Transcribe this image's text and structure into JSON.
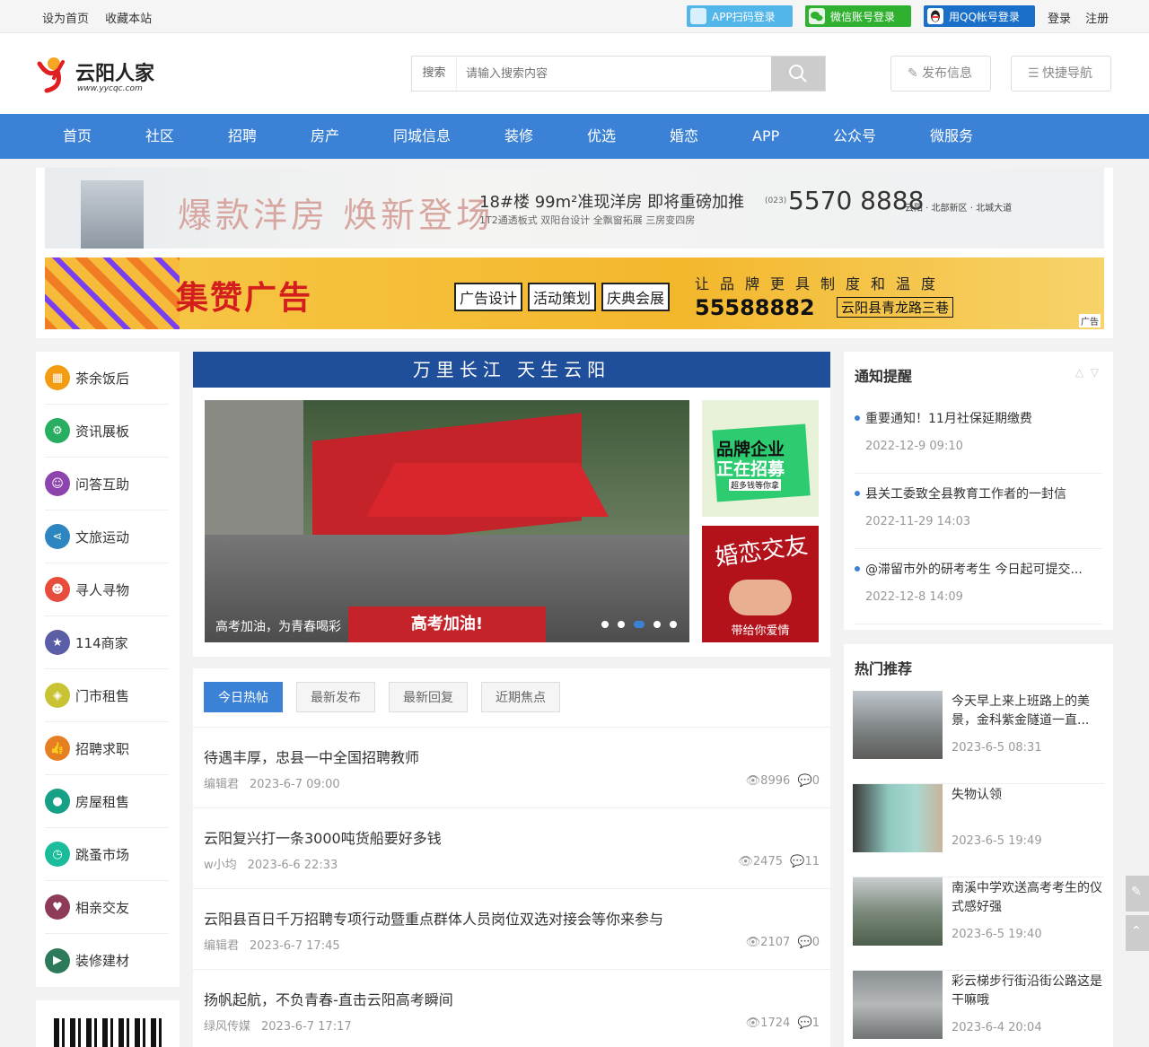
{
  "topbar": {
    "set_home": "设为首页",
    "bookmark": "收藏本站",
    "app_login": "APP扫码登录",
    "wechat_login": "微信账号登录",
    "qq_login": "用QQ帐号登录",
    "login": "登录",
    "register": "注册"
  },
  "header": {
    "logo_text": "云阳人家",
    "logo_url": "www.yycqc.com",
    "search_label": "搜索",
    "search_placeholder": "请输入搜索内容",
    "publish": "发布信息",
    "quick_nav": "快捷导航"
  },
  "nav": [
    "首页",
    "社区",
    "招聘",
    "房产",
    "同城信息",
    "装修",
    "优选",
    "婚恋",
    "APP",
    "公众号",
    "微服务"
  ],
  "banner1": {
    "headline": "爆款洋房 焕新登场",
    "line1": "18#楼 99m²准现洋房 即将重磅加推",
    "line2": "1T2通透板式  双阳台设计  全飘窗拓展  三房变四房",
    "phone_prefix": "(023)",
    "phone": "5570 8888",
    "address": "云阳 · 北部新区 · 北城大道"
  },
  "banner2": {
    "brand": "集赞广告",
    "services": [
      "广告设计",
      "活动策划",
      "庆典会展"
    ],
    "slogan": "让品牌更具制度和温度",
    "phone": "55588882",
    "address": "云阳县青龙路三巷",
    "ad_tag": "广告"
  },
  "sidebar": [
    {
      "label": "茶余饭后",
      "color": "#f39c12"
    },
    {
      "label": "资讯展板",
      "color": "#27ae60"
    },
    {
      "label": "问答互助",
      "color": "#8e44ad"
    },
    {
      "label": "文旅运动",
      "color": "#2e86c1"
    },
    {
      "label": "寻人寻物",
      "color": "#e74c3c"
    },
    {
      "label": "114商家",
      "color": "#5b5ea6"
    },
    {
      "label": "门市租售",
      "color": "#c9c233"
    },
    {
      "label": "招聘求职",
      "color": "#e67e22"
    },
    {
      "label": "房屋租售",
      "color": "#16a085"
    },
    {
      "label": "跳蚤市场",
      "color": "#1abc9c"
    },
    {
      "label": "相亲交友",
      "color": "#8e3a59"
    },
    {
      "label": "装修建材",
      "color": "#2c7a5a"
    }
  ],
  "slogan": "万里长江 天生云阳",
  "slide": {
    "caption": "高考加油，为青春喝彩",
    "banner_text": "高考加油!",
    "dots": 5,
    "active_dot": 3
  },
  "thumb1": {
    "line1": "品牌企业",
    "line2": "正在招募",
    "line3": "超多钱等你拿"
  },
  "thumb2": {
    "title": "婚恋交友",
    "caption": "带给你爱情"
  },
  "tabs": [
    "今日热帖",
    "最新发布",
    "最新回复",
    "近期焦点"
  ],
  "posts": [
    {
      "title": "待遇丰厚，忠县一中全国招聘教师",
      "author": "编辑君",
      "date": "2023-6-7 09:00",
      "views": "8996",
      "replies": "0"
    },
    {
      "title": "云阳复兴打一条3000吨货船要好多钱",
      "author": "w小均",
      "date": "2023-6-6 22:33",
      "views": "2475",
      "replies": "11"
    },
    {
      "title": "云阳县百日千万招聘专项行动暨重点群体人员岗位双选对接会等你来参与",
      "author": "编辑君",
      "date": "2023-6-7 17:45",
      "views": "2107",
      "replies": "0"
    },
    {
      "title": "扬帆起航，不负青春-直击云阳高考瞬间",
      "author": "绿风传媒",
      "date": "2023-6-7 17:17",
      "views": "1724",
      "replies": "1"
    }
  ],
  "notices": {
    "title": "通知提醒",
    "items": [
      {
        "title": "重要通知！11月社保延期缴费",
        "date": "2022-12-9 09:10"
      },
      {
        "title": "县关工委致全县教育工作者的一封信",
        "date": "2022-11-29 14:03"
      },
      {
        "title": "@滞留市外的研考考生 今日起可提交...",
        "date": "2022-12-8 14:09"
      }
    ]
  },
  "hot": {
    "title": "热门推荐",
    "items": [
      {
        "title": "今天早上来上班路上的美景，金科紫金隧道一直...",
        "date": "2023-6-5 08:31"
      },
      {
        "title": "失物认领",
        "date": "2023-6-5 19:49"
      },
      {
        "title": "南溪中学欢送高考考生的仪式感好强",
        "date": "2023-6-5 19:40"
      },
      {
        "title": "彩云梯步行街沿街公路这是干嘛哦",
        "date": "2023-6-4 20:04"
      }
    ]
  }
}
